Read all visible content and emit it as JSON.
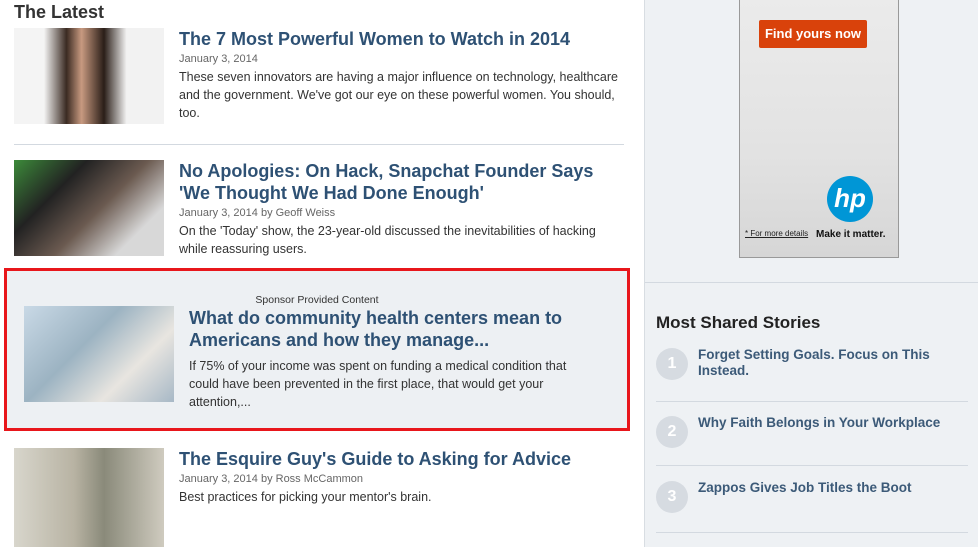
{
  "latest": {
    "heading": "The Latest",
    "articles": [
      {
        "title": "The 7 Most Powerful Women to Watch in 2014",
        "meta": "January 3, 2014",
        "desc": "These seven innovators are having a major influence on technology, healthcare and the government. We've got our eye on these powerful women. You should, too."
      },
      {
        "title": "No Apologies: On Hack, Snapchat Founder Says 'We Thought We Had Done Enough'",
        "meta": "January 3, 2014 by Geoff Weiss",
        "desc": "On the 'Today' show, the 23-year-old discussed the inevitabilities of hacking while reassuring users."
      },
      {
        "title": "The Esquire Guy's Guide to Asking for Advice",
        "meta": "January 3, 2014 by Ross McCammon",
        "desc": "Best practices for picking your mentor's brain."
      }
    ],
    "sponsored": {
      "label": "Sponsor Provided Content",
      "title": "What do community health centers mean to Americans and how they manage...",
      "desc": "If 75% of your income was spent on funding a medical condition that could have been prevented in the first place, that would get your attention,..."
    }
  },
  "ad": {
    "button": "Find yours now",
    "logo": "hp",
    "details": "* For more details",
    "tagline": "Make it matter.",
    "button_color": "#d9420b"
  },
  "most_shared": {
    "heading": "Most Shared Stories",
    "items": [
      {
        "num": "1",
        "title": "Forget Setting Goals. Focus on This Instead."
      },
      {
        "num": "2",
        "title": "Why Faith Belongs in Your Workplace"
      },
      {
        "num": "3",
        "title": "Zappos Gives Job Titles the Boot"
      }
    ]
  }
}
